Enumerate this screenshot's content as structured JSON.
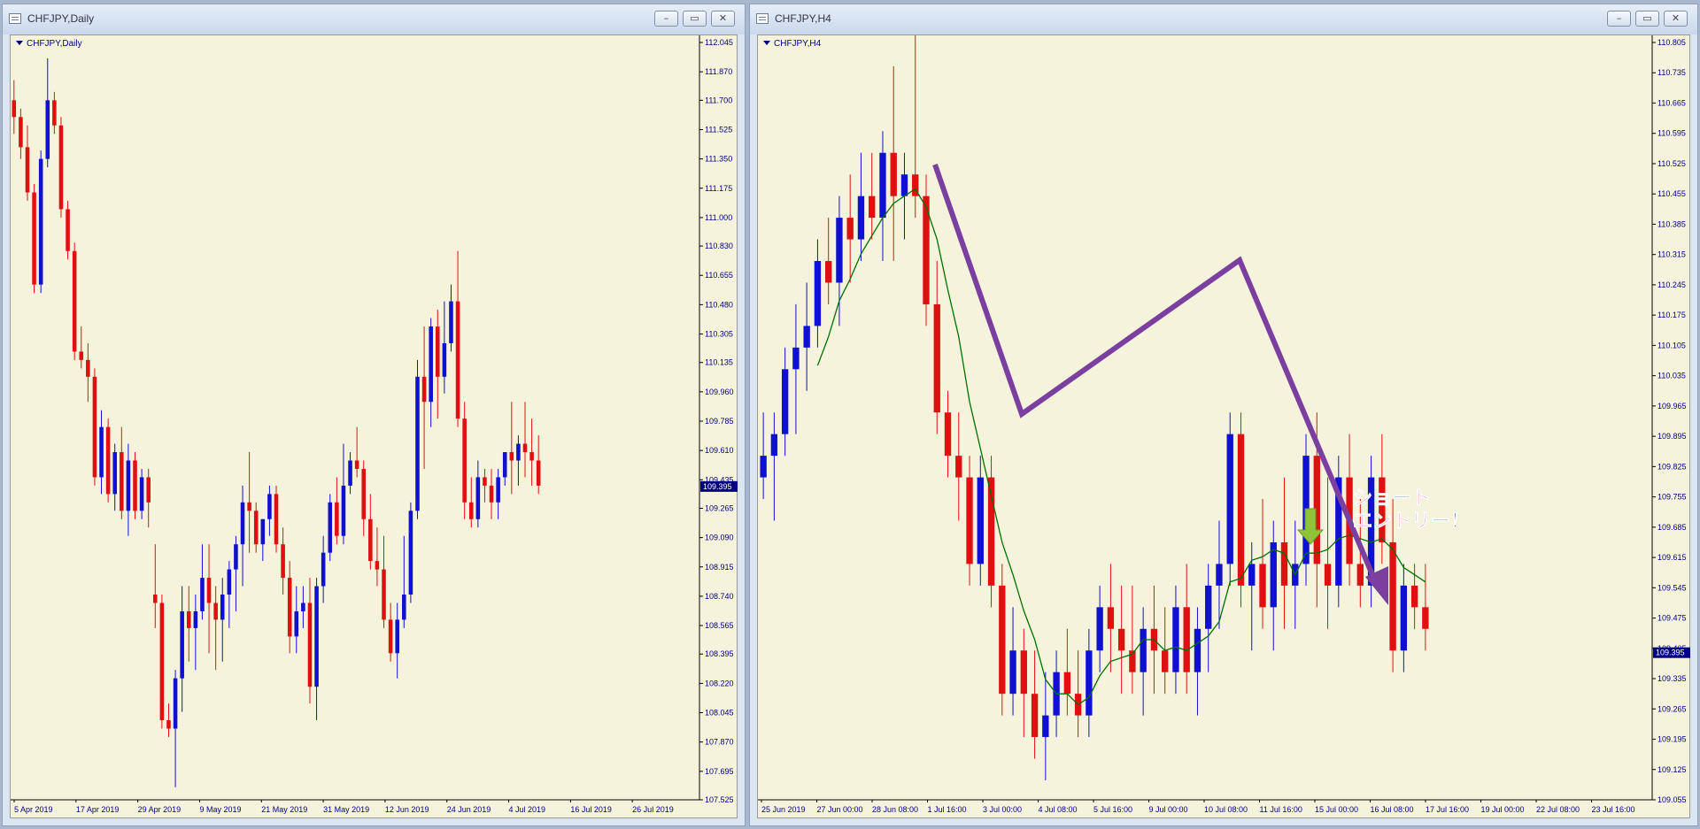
{
  "windows": [
    {
      "title": "CHFJPY,Daily",
      "symbol_label": "CHFJPY,Daily",
      "buttons": [
        "–",
        "▭",
        "✕"
      ]
    },
    {
      "title": "CHFJPY,H4",
      "symbol_label": "CHFJPY,H4",
      "buttons": [
        "–",
        "▭",
        "✕"
      ]
    }
  ],
  "annotation": {
    "text_line1": "ショート",
    "text_line2": "エントリー！",
    "arrow_color": "#7b3fa0",
    "entry_arrow_color": "#8fc43a",
    "text_color": "#e8178a"
  },
  "colors": {
    "bull": "#1010d0",
    "bear": "#e01010",
    "ma": "#007000",
    "axis_text": "#000080",
    "background": "#f5f3dc",
    "price_tag_bg": "#000080"
  },
  "chart_data": [
    {
      "type": "candlestick",
      "symbol": "CHFJPY",
      "timeframe": "Daily",
      "y_ticks": [
        "112.045",
        "111.870",
        "111.700",
        "111.525",
        "111.350",
        "111.175",
        "111.000",
        "110.830",
        "110.655",
        "110.480",
        "110.305",
        "110.135",
        "109.960",
        "109.785",
        "109.610",
        "109.435",
        "109.265",
        "109.090",
        "108.915",
        "108.740",
        "108.565",
        "108.395",
        "108.220",
        "108.045",
        "107.870",
        "107.695",
        "107.525"
      ],
      "ylim": [
        107.525,
        112.045
      ],
      "x_labels": [
        "5 Apr 2019",
        "17 Apr 2019",
        "29 Apr 2019",
        "9 May 2019",
        "21 May 2019",
        "31 May 2019",
        "12 Jun 2019",
        "24 Jun 2019",
        "4 Jul 2019",
        "16 Jul 2019",
        "26 Jul 2019"
      ],
      "current_price": "109.395",
      "candles": [
        [
          111.7,
          111.82,
          111.5,
          111.6
        ],
        [
          111.6,
          111.65,
          111.35,
          111.42
        ],
        [
          111.42,
          111.55,
          111.1,
          111.15
        ],
        [
          111.15,
          111.2,
          110.55,
          110.6
        ],
        [
          110.6,
          111.4,
          110.55,
          111.35
        ],
        [
          111.35,
          111.95,
          111.3,
          111.7
        ],
        [
          111.7,
          111.75,
          111.5,
          111.55
        ],
        [
          111.55,
          111.6,
          111.0,
          111.05
        ],
        [
          111.05,
          111.1,
          110.75,
          110.8
        ],
        [
          110.8,
          110.85,
          110.15,
          110.2
        ],
        [
          110.2,
          110.35,
          110.1,
          110.15
        ],
        [
          110.15,
          110.25,
          109.9,
          110.05
        ],
        [
          110.05,
          110.1,
          109.4,
          109.45
        ],
        [
          109.45,
          109.85,
          109.35,
          109.75
        ],
        [
          109.75,
          109.8,
          109.3,
          109.35
        ],
        [
          109.35,
          109.65,
          109.25,
          109.6
        ],
        [
          109.6,
          109.75,
          109.2,
          109.25
        ],
        [
          109.25,
          109.65,
          109.1,
          109.55
        ],
        [
          109.55,
          109.6,
          109.2,
          109.25
        ],
        [
          109.25,
          109.5,
          109.2,
          109.45
        ],
        [
          109.45,
          109.5,
          109.15,
          109.3
        ],
        [
          108.75,
          109.05,
          108.55,
          108.7
        ],
        [
          108.7,
          108.75,
          107.95,
          108.0
        ],
        [
          108.0,
          108.1,
          107.9,
          107.95
        ],
        [
          107.95,
          108.3,
          107.6,
          108.25
        ],
        [
          108.25,
          108.8,
          108.05,
          108.65
        ],
        [
          108.65,
          108.8,
          108.35,
          108.55
        ],
        [
          108.55,
          108.75,
          108.3,
          108.65
        ],
        [
          108.65,
          109.05,
          108.6,
          108.85
        ],
        [
          108.85,
          109.05,
          108.4,
          108.7
        ],
        [
          108.7,
          108.8,
          108.3,
          108.6
        ],
        [
          108.6,
          108.85,
          108.35,
          108.75
        ],
        [
          108.75,
          108.95,
          108.55,
          108.9
        ],
        [
          108.9,
          109.1,
          108.65,
          109.05
        ],
        [
          109.05,
          109.4,
          108.8,
          109.3
        ],
        [
          109.3,
          109.6,
          109.0,
          109.25
        ],
        [
          109.25,
          109.3,
          109.0,
          109.05
        ],
        [
          109.05,
          109.2,
          108.95,
          109.2
        ],
        [
          109.2,
          109.4,
          109.1,
          109.35
        ],
        [
          109.35,
          109.4,
          109.0,
          109.05
        ],
        [
          109.05,
          109.15,
          108.75,
          108.85
        ],
        [
          108.85,
          108.95,
          108.4,
          108.5
        ],
        [
          108.5,
          108.8,
          108.4,
          108.65
        ],
        [
          108.65,
          108.8,
          108.55,
          108.7
        ],
        [
          108.7,
          108.85,
          108.1,
          108.2
        ],
        [
          108.2,
          108.85,
          108.0,
          108.8
        ],
        [
          108.8,
          109.1,
          108.7,
          109.0
        ],
        [
          109.0,
          109.35,
          108.95,
          109.3
        ],
        [
          109.3,
          109.45,
          109.05,
          109.1
        ],
        [
          109.1,
          109.65,
          109.05,
          109.4
        ],
        [
          109.4,
          109.6,
          109.35,
          109.55
        ],
        [
          109.55,
          109.75,
          109.45,
          109.5
        ],
        [
          109.5,
          109.55,
          109.1,
          109.2
        ],
        [
          109.2,
          109.35,
          108.9,
          108.95
        ],
        [
          108.95,
          109.15,
          108.8,
          108.9
        ],
        [
          108.9,
          109.1,
          108.55,
          108.6
        ],
        [
          108.6,
          108.7,
          108.35,
          108.4
        ],
        [
          108.4,
          108.7,
          108.25,
          108.6
        ],
        [
          108.6,
          109.1,
          108.55,
          108.75
        ],
        [
          108.75,
          109.3,
          108.7,
          109.25
        ],
        [
          109.25,
          110.15,
          109.2,
          110.05
        ],
        [
          110.05,
          110.35,
          109.5,
          109.9
        ],
        [
          109.9,
          110.4,
          109.75,
          110.35
        ],
        [
          110.35,
          110.45,
          109.8,
          110.05
        ],
        [
          110.05,
          110.5,
          109.95,
          110.25
        ],
        [
          110.25,
          110.6,
          110.2,
          110.5
        ],
        [
          110.5,
          110.8,
          109.75,
          109.8
        ],
        [
          109.8,
          109.9,
          109.2,
          109.3
        ],
        [
          109.3,
          109.45,
          109.15,
          109.2
        ],
        [
          109.2,
          109.55,
          109.15,
          109.45
        ],
        [
          109.45,
          109.5,
          109.3,
          109.4
        ],
        [
          109.4,
          109.5,
          109.2,
          109.3
        ],
        [
          109.3,
          109.5,
          109.2,
          109.45
        ],
        [
          109.45,
          109.6,
          109.4,
          109.6
        ],
        [
          109.6,
          109.9,
          109.35,
          109.55
        ],
        [
          109.55,
          109.7,
          109.4,
          109.65
        ],
        [
          109.65,
          109.9,
          109.45,
          109.6
        ],
        [
          109.6,
          109.8,
          109.4,
          109.55
        ],
        [
          109.55,
          109.7,
          109.35,
          109.4
        ]
      ]
    },
    {
      "type": "candlestick",
      "symbol": "CHFJPY",
      "timeframe": "H4",
      "y_ticks": [
        "110.805",
        "110.735",
        "110.665",
        "110.595",
        "110.525",
        "110.455",
        "110.385",
        "110.315",
        "110.245",
        "110.175",
        "110.105",
        "110.035",
        "109.965",
        "109.895",
        "109.825",
        "109.755",
        "109.685",
        "109.615",
        "109.545",
        "109.475",
        "109.405",
        "109.335",
        "109.265",
        "109.195",
        "109.125",
        "109.055"
      ],
      "ylim": [
        109.055,
        110.805
      ],
      "x_labels": [
        "25 Jun 2019",
        "27 Jun 00:00",
        "28 Jun 08:00",
        "1 Jul 16:00",
        "3 Jul 00:00",
        "4 Jul 08:00",
        "5 Jul 16:00",
        "9 Jul 00:00",
        "10 Jul 08:00",
        "11 Jul 16:00",
        "15 Jul 00:00",
        "16 Jul 08:00",
        "17 Jul 16:00",
        "19 Jul 00:00",
        "22 Jul 08:00",
        "23 Jul 16:00"
      ],
      "current_price": "109.395",
      "moving_average_label": "MA",
      "candles": [
        [
          109.8,
          109.95,
          109.75,
          109.85
        ],
        [
          109.85,
          109.95,
          109.7,
          109.9
        ],
        [
          109.9,
          110.1,
          109.85,
          110.05
        ],
        [
          110.05,
          110.2,
          109.9,
          110.1
        ],
        [
          110.1,
          110.25,
          110.0,
          110.15
        ],
        [
          110.15,
          110.35,
          110.1,
          110.3
        ],
        [
          110.3,
          110.4,
          110.2,
          110.25
        ],
        [
          110.25,
          110.45,
          110.15,
          110.4
        ],
        [
          110.4,
          110.5,
          110.25,
          110.35
        ],
        [
          110.35,
          110.55,
          110.3,
          110.45
        ],
        [
          110.45,
          110.55,
          110.35,
          110.4
        ],
        [
          110.4,
          110.6,
          110.3,
          110.55
        ],
        [
          110.55,
          110.75,
          110.3,
          110.45
        ],
        [
          110.45,
          110.55,
          110.35,
          110.5
        ],
        [
          110.5,
          110.85,
          110.4,
          110.45
        ],
        [
          110.45,
          110.5,
          110.15,
          110.2
        ],
        [
          110.2,
          110.3,
          109.9,
          109.95
        ],
        [
          109.95,
          110.0,
          109.8,
          109.85
        ],
        [
          109.85,
          109.95,
          109.7,
          109.8
        ],
        [
          109.8,
          109.85,
          109.55,
          109.6
        ],
        [
          109.6,
          109.85,
          109.55,
          109.8
        ],
        [
          109.8,
          109.85,
          109.5,
          109.55
        ],
        [
          109.55,
          109.6,
          109.25,
          109.3
        ],
        [
          109.3,
          109.5,
          109.25,
          109.4
        ],
        [
          109.4,
          109.45,
          109.2,
          109.3
        ],
        [
          109.3,
          109.4,
          109.15,
          109.2
        ],
        [
          109.2,
          109.35,
          109.1,
          109.25
        ],
        [
          109.25,
          109.4,
          109.2,
          109.35
        ],
        [
          109.35,
          109.45,
          109.25,
          109.3
        ],
        [
          109.3,
          109.4,
          109.2,
          109.25
        ],
        [
          109.25,
          109.45,
          109.2,
          109.4
        ],
        [
          109.4,
          109.55,
          109.35,
          109.5
        ],
        [
          109.5,
          109.6,
          109.35,
          109.45
        ],
        [
          109.45,
          109.55,
          109.3,
          109.4
        ],
        [
          109.4,
          109.55,
          109.3,
          109.35
        ],
        [
          109.35,
          109.5,
          109.25,
          109.45
        ],
        [
          109.45,
          109.55,
          109.3,
          109.4
        ],
        [
          109.4,
          109.5,
          109.3,
          109.35
        ],
        [
          109.35,
          109.55,
          109.3,
          109.5
        ],
        [
          109.5,
          109.6,
          109.3,
          109.35
        ],
        [
          109.35,
          109.5,
          109.25,
          109.45
        ],
        [
          109.45,
          109.6,
          109.35,
          109.55
        ],
        [
          109.55,
          109.7,
          109.45,
          109.6
        ],
        [
          109.6,
          109.95,
          109.55,
          109.9
        ],
        [
          109.9,
          109.95,
          109.5,
          109.55
        ],
        [
          109.55,
          109.65,
          109.4,
          109.6
        ],
        [
          109.6,
          109.75,
          109.45,
          109.5
        ],
        [
          109.5,
          109.7,
          109.4,
          109.65
        ],
        [
          109.65,
          109.8,
          109.45,
          109.55
        ],
        [
          109.55,
          109.7,
          109.45,
          109.6
        ],
        [
          109.6,
          109.9,
          109.55,
          109.85
        ],
        [
          109.85,
          109.95,
          109.5,
          109.6
        ],
        [
          109.6,
          109.8,
          109.45,
          109.55
        ],
        [
          109.55,
          109.85,
          109.5,
          109.8
        ],
        [
          109.8,
          109.9,
          109.55,
          109.6
        ],
        [
          109.6,
          109.75,
          109.5,
          109.55
        ],
        [
          109.55,
          109.85,
          109.5,
          109.8
        ],
        [
          109.8,
          109.9,
          109.6,
          109.65
        ],
        [
          109.65,
          109.75,
          109.35,
          109.4
        ],
        [
          109.4,
          109.6,
          109.35,
          109.55
        ],
        [
          109.55,
          109.6,
          109.45,
          109.5
        ],
        [
          109.5,
          109.6,
          109.4,
          109.45
        ]
      ]
    }
  ]
}
